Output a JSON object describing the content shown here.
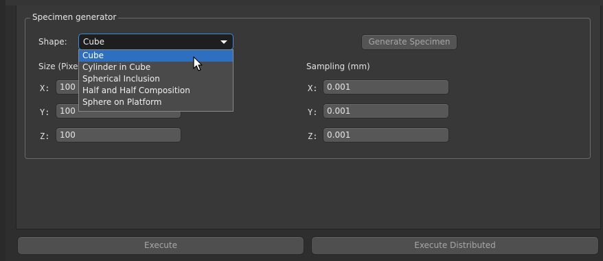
{
  "group": {
    "title": "Specimen generator"
  },
  "shape": {
    "label": "Shape:",
    "value": "Cube",
    "options": [
      "Cube",
      "Cylinder in Cube",
      "Spherical Inclusion",
      "Half and Half Composition",
      "Sphere on Platform"
    ],
    "selected_index": 0
  },
  "generate_button": "Generate Specimen",
  "size": {
    "label": "Size (Pixe",
    "x_label": "X:",
    "y_label": "Y:",
    "z_label": "Z:",
    "x": "100",
    "y": "100",
    "z": "100"
  },
  "sampling": {
    "label": "Sampling (mm)",
    "x_label": "X:",
    "y_label": "Y:",
    "z_label": "Z:",
    "x": "0.001",
    "y": "0.001",
    "z": "0.001"
  },
  "footer": {
    "execute": "Execute",
    "execute_distributed": "Execute Distributed"
  }
}
